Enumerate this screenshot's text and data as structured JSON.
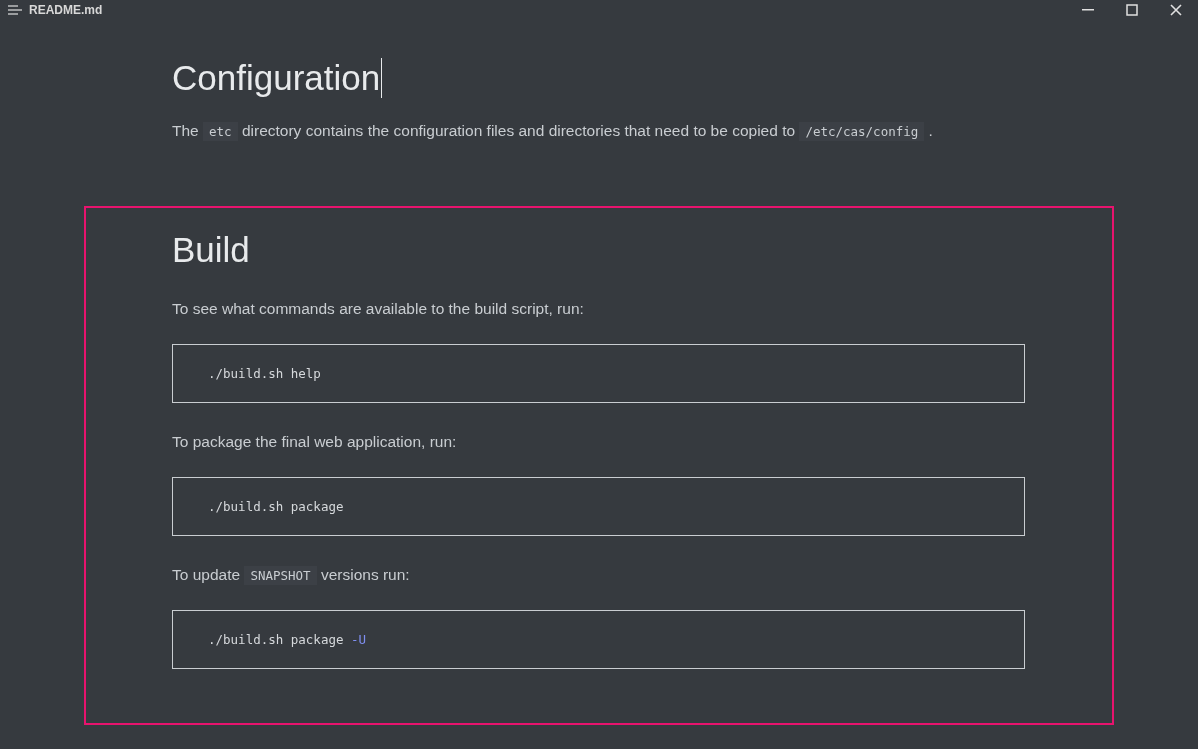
{
  "window": {
    "title": "README.md"
  },
  "sections": [
    {
      "heading": "Configuration",
      "cursor": true,
      "highlighted": false,
      "blocks": [
        {
          "kind": "paragraph",
          "segments": [
            {
              "kind": "text",
              "text": "The "
            },
            {
              "kind": "code",
              "text": "etc"
            },
            {
              "kind": "text",
              "text": " directory contains the configuration files and directories that need to be copied to "
            },
            {
              "kind": "code",
              "text": "/etc/cas/config"
            },
            {
              "kind": "text",
              "text": " ."
            }
          ]
        }
      ]
    },
    {
      "heading": "Build",
      "cursor": false,
      "highlighted": true,
      "blocks": [
        {
          "kind": "paragraph",
          "segments": [
            {
              "kind": "text",
              "text": "To see what commands are available to the build script, run:"
            }
          ]
        },
        {
          "kind": "code_block",
          "segments": [
            {
              "kind": "plain",
              "text": "./build.sh help"
            }
          ]
        },
        {
          "kind": "paragraph",
          "segments": [
            {
              "kind": "text",
              "text": "To package the final web application, run:"
            }
          ]
        },
        {
          "kind": "code_block",
          "segments": [
            {
              "kind": "plain",
              "text": "./build.sh package"
            }
          ]
        },
        {
          "kind": "paragraph",
          "segments": [
            {
              "kind": "text",
              "text": "To update "
            },
            {
              "kind": "code",
              "text": "SNAPSHOT"
            },
            {
              "kind": "text",
              "text": " versions run:"
            }
          ]
        },
        {
          "kind": "code_block",
          "segments": [
            {
              "kind": "plain",
              "text": "./build.sh package "
            },
            {
              "kind": "flag",
              "text": "-U"
            }
          ]
        }
      ]
    }
  ]
}
